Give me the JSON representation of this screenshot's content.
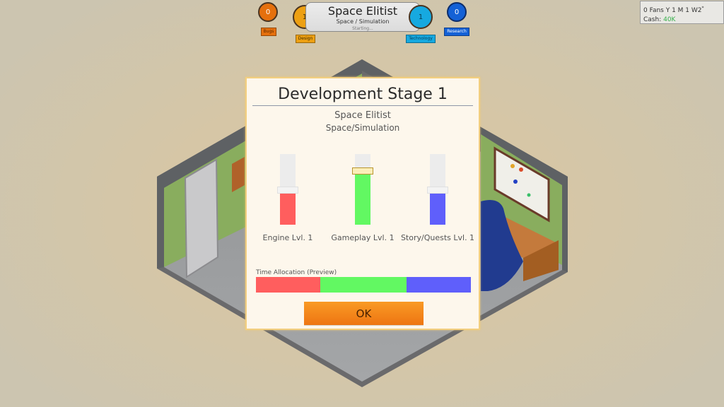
{
  "hud": {
    "game_title": "Space Elitist",
    "game_genre": "Space / Simulation",
    "status": "Starting...",
    "stats": {
      "bugs": {
        "value": "0",
        "label": "Bugs",
        "color": "#e5700d"
      },
      "design": {
        "value": "1",
        "label": "Design",
        "color": "#eda013"
      },
      "technology": {
        "value": "1",
        "label": "Technology",
        "color": "#16a9e0"
      },
      "research": {
        "value": "0",
        "label": "Research",
        "color": "#1461d6"
      }
    }
  },
  "info": {
    "fans_date": "0 Fans Y 1 M 1 W2",
    "cash_label": "Cash:",
    "cash_value": "40K",
    "cash_color": "#36b04a"
  },
  "dialog": {
    "title": "Development Stage 1",
    "game_name": "Space Elitist",
    "genre": "Space/Simulation",
    "sliders": [
      {
        "label": "Engine Lvl. 1",
        "value_fraction": 0.45,
        "color": "#ff5e5e",
        "active": false
      },
      {
        "label": "Gameplay Lvl. 1",
        "value_fraction": 0.72,
        "color": "#62f862",
        "active": true
      },
      {
        "label": "Story/Quests Lvl. 1",
        "value_fraction": 0.45,
        "color": "#5f5ffb",
        "active": false
      }
    ],
    "time_allocation": {
      "label": "Time Allocation (Preview)",
      "segments": [
        {
          "name": "Engine",
          "percent": 30,
          "color": "#ff5e5e"
        },
        {
          "name": "Gameplay",
          "percent": 40,
          "color": "#62f862"
        },
        {
          "name": "Story/Quests",
          "percent": 30,
          "color": "#5f5ffb"
        }
      ]
    },
    "ok_label": "OK"
  }
}
